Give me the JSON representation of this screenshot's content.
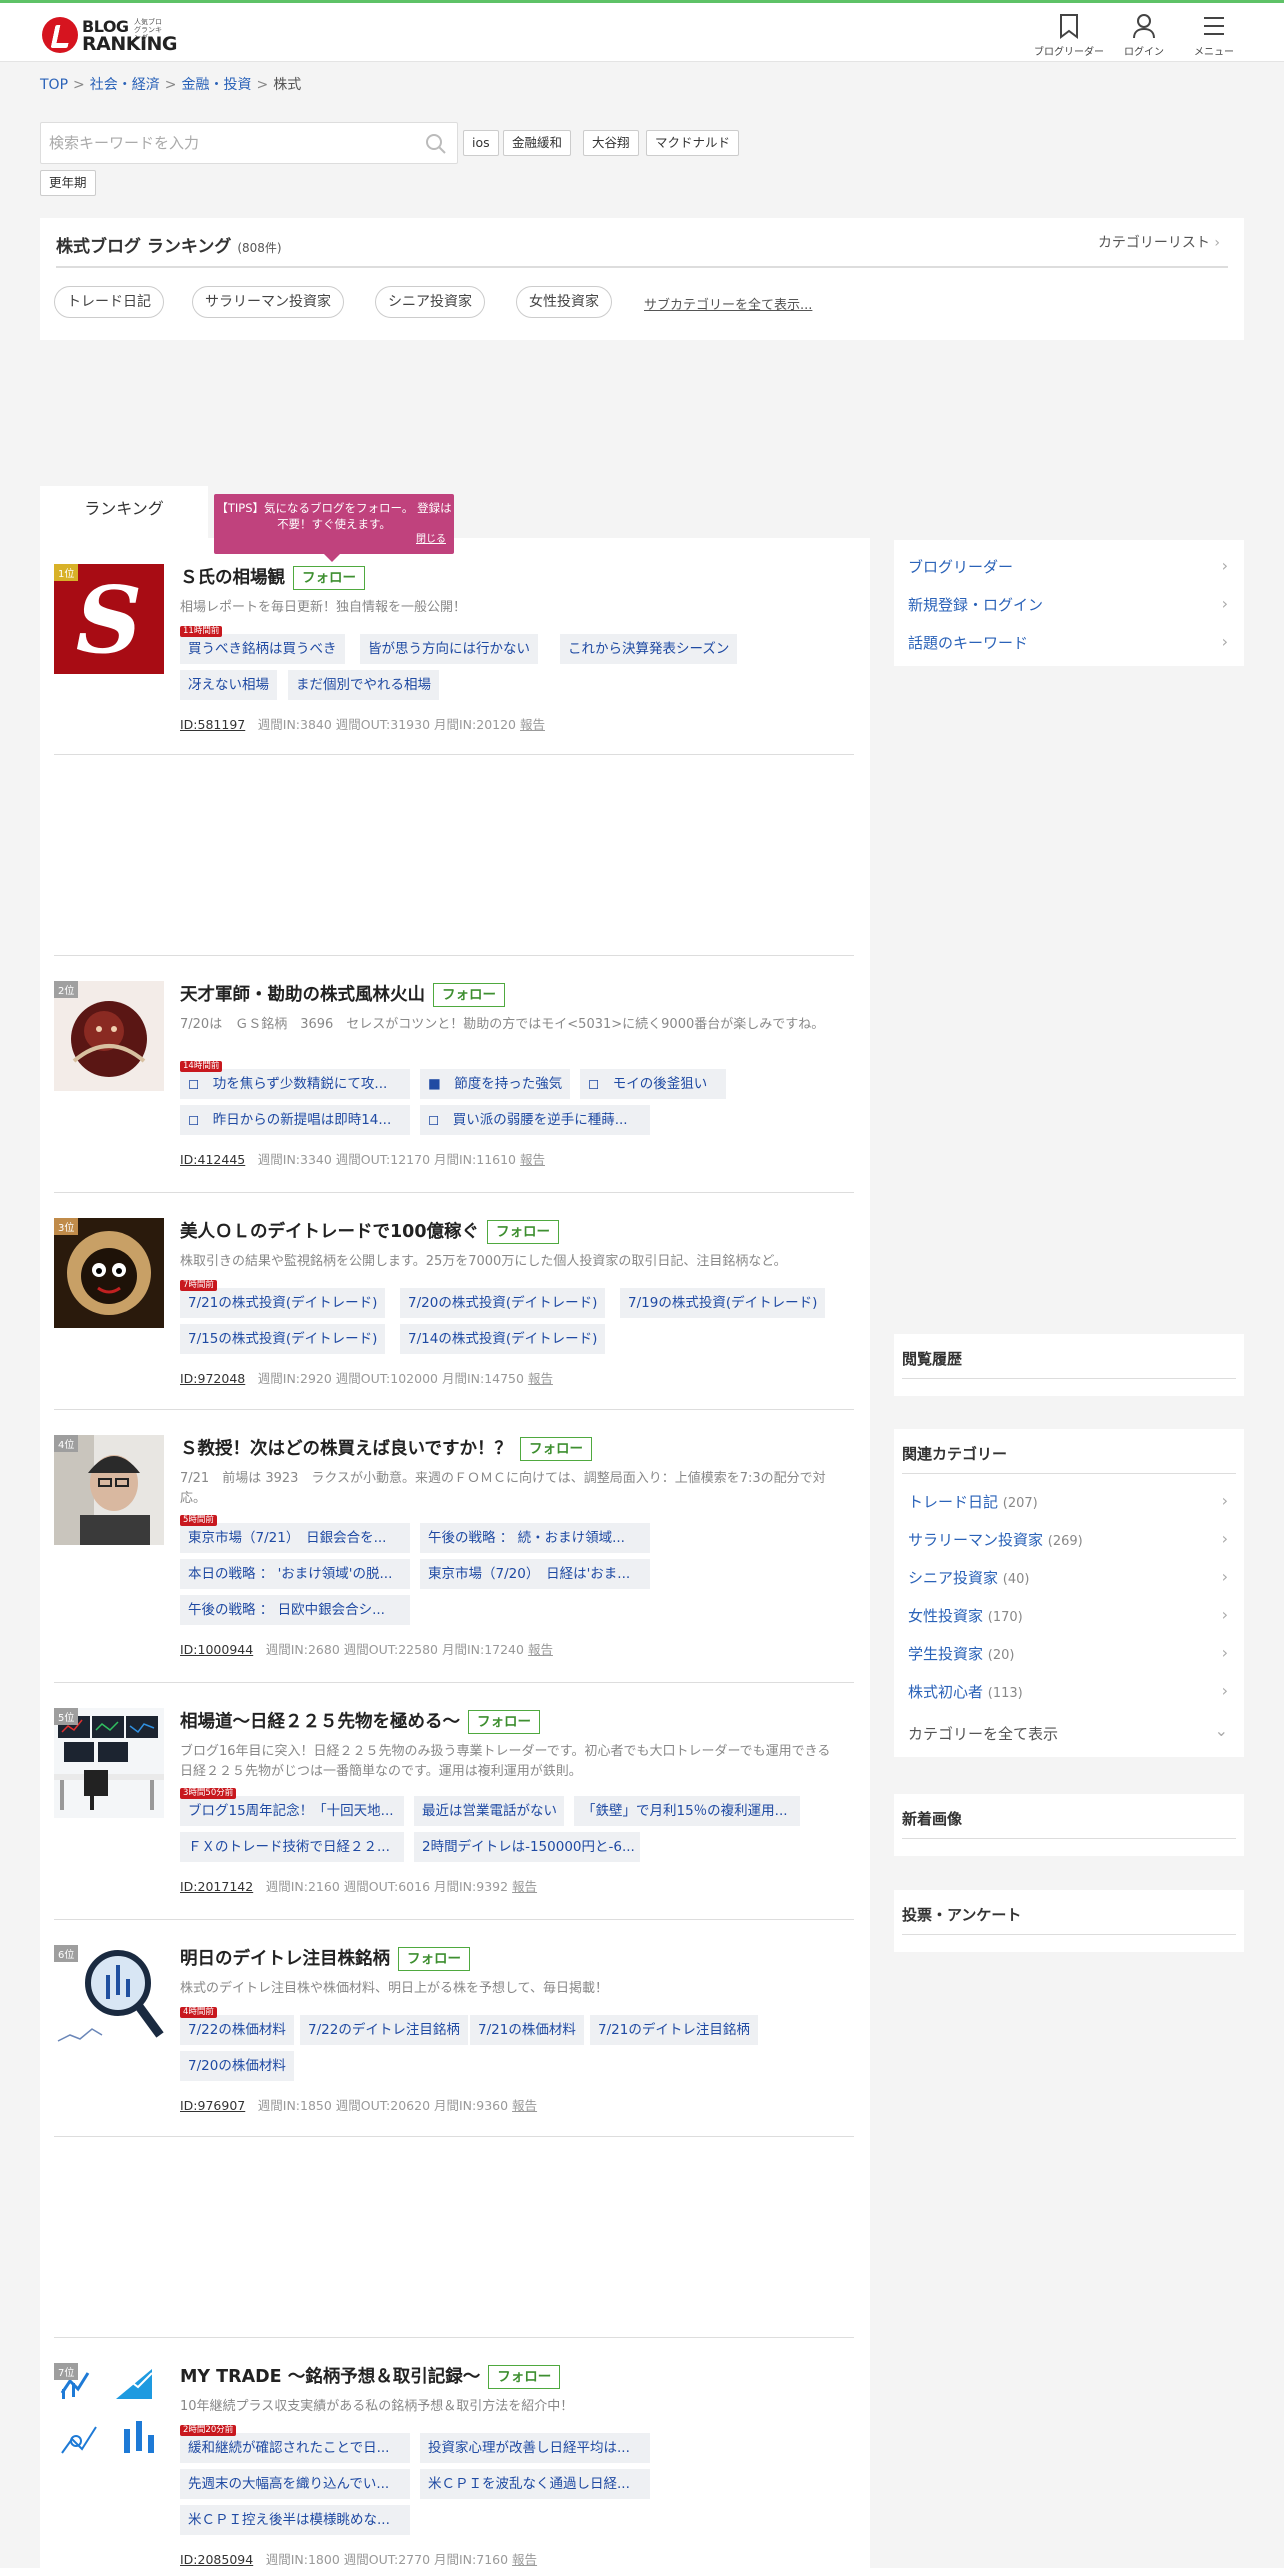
{
  "header": {
    "logo_text_1": "BLOG",
    "logo_text_2": "RANKING",
    "logo_small": "人気ブログランキング",
    "nav": [
      {
        "label": "ブログリーダー",
        "icon": "bookmark-icon"
      },
      {
        "label": "ログイン",
        "icon": "user-icon"
      },
      {
        "label": "メニュー",
        "icon": "hamburger-icon"
      }
    ]
  },
  "breadcrumb": {
    "items": [
      "TOP",
      "社会・経済",
      "金融・投資"
    ],
    "current": "株式",
    "sep": ">"
  },
  "search": {
    "placeholder": "検索キーワードを入力",
    "keywords": [
      "ios",
      "金融緩和",
      "大谷翔",
      "マクドナルド",
      "更年期"
    ]
  },
  "ranking_header": {
    "title": "株式ブログ ランキング",
    "count": "(808件)",
    "category_list": "カテゴリーリスト",
    "pills": [
      "トレード日記",
      "サラリーマン投資家",
      "シニア投資家",
      "女性投資家"
    ],
    "subcat_link": "サブカテゴリーを全て表示..."
  },
  "tab": {
    "label": "ランキング"
  },
  "tips": {
    "text": "【TIPS】気になるブログをフォロー。 登録は不要！すぐ使えます。",
    "close": "閉じる"
  },
  "follow_label": "フォロー",
  "entries": [
    {
      "rank": "1位",
      "title": "Ｓ氏の相場観",
      "desc": "相場レポートを毎日更新！独自情報を一般公開！",
      "badge": "11時間前",
      "tags": [
        "買うべき銘柄は買うべき",
        "皆が思う方向には行かない",
        "これから決算発表シーズン",
        "冴えない相場",
        "まだ個別でやれる相場"
      ],
      "id": "ID:581197",
      "stats": "週間IN:3840 週間OUT:31930 月間IN:20120",
      "report": "報告"
    },
    {
      "rank": "2位",
      "title": "天才軍師・勘助の株式風林火山",
      "desc": "7/20は　ＧＳ銘柄　3696　セレスがコツンと！勘助の方ではモイ<5031>に続く9000番台が楽しみですね。",
      "badge": "14時間前",
      "tags": [
        "◻　功を焦らず少数精鋭にて攻...",
        "■　節度を持った強気",
        "◻　モイの後釜狙い",
        "◻　昨日からの新提唱は即時14...",
        "◻　買い派の弱腰を逆手に種蒔..."
      ],
      "id": "ID:412445",
      "stats": "週間IN:3340 週間OUT:12170 月間IN:11610",
      "report": "報告"
    },
    {
      "rank": "3位",
      "title": "美人ＯＬのデイトレードで100億稼ぐ",
      "desc": "株取引きの結果や監視銘柄を公開します。25万を7000万にした個人投資家の取引日記、注目銘柄など。",
      "badge": "7時間前",
      "tags": [
        "7/21の株式投資(デイトレード)",
        "7/20の株式投資(デイトレード)",
        "7/19の株式投資(デイトレード)",
        "7/15の株式投資(デイトレード)",
        "7/14の株式投資(デイトレード)"
      ],
      "id": "ID:972048",
      "stats": "週間IN:2920 週間OUT:102000 月間IN:14750",
      "report": "報告"
    },
    {
      "rank": "4位",
      "title": "Ｓ教授！次はどの株買えば良いですか！？",
      "desc": "7/21　前場は 3923　ラクスが小動意。来週のＦＯＭＣに向けては、調整局面入り：上値模索を7:3の配分で対応。",
      "badge": "5時間前",
      "tags": [
        "東京市場（7/21）　日銀会合を...",
        "午後の戦略 ： 続・おまけ領域...",
        "本日の戦略 ： 'おまけ領域'の脱...",
        "東京市場（7/20）　日経は'おま...",
        "午後の戦略 ： 日欧中銀会合シ..."
      ],
      "id": "ID:1000944",
      "stats": "週間IN:2680 週間OUT:22580 月間IN:17240",
      "report": "報告"
    },
    {
      "rank": "5位",
      "title": "相場道〜日経２２５先物を極める〜",
      "desc": "ブログ16年目に突入！日経２２５先物のみ扱う専業トレーダーです。初心者でも大口トレーダーでも運用できる日経２２５先物がじつは一番簡単なのです。運用は複利運用が鉄則。",
      "badge": "3時間50分前",
      "tags": [
        "ブログ15周年記念！「十回天地...",
        "最近は営業電話がない",
        "「鉄壁」で月利15％の複利運用...",
        "ＦＸのトレード技術で日経２２...",
        "2時間デイトレは-150000円と-6..."
      ],
      "id": "ID:2017142",
      "stats": "週間IN:2160 週間OUT:6016 月間IN:9392",
      "report": "報告"
    },
    {
      "rank": "6位",
      "title": "明日のデイトレ注目株銘柄",
      "desc": "株式のデイトレ注目株や株価材料、明日上がる株を予想して、毎日掲載！",
      "badge": "4時間前",
      "tags": [
        "7/22の株価材料",
        "7/22のデイトレ注目銘柄",
        "7/21の株価材料",
        "7/21のデイトレ注目銘柄",
        "7/20の株価材料"
      ],
      "id": "ID:976907",
      "stats": "週間IN:1850 週間OUT:20620 月間IN:9360",
      "report": "報告"
    },
    {
      "rank": "7位",
      "title": "MY TRADE 〜銘柄予想＆取引記録〜",
      "desc": "10年継続プラス収支実績がある私の銘柄予想＆取引方法を紹介中！",
      "badge": "2時間20分前",
      "tags": [
        "緩和継続が確認されたことで日...",
        "投資家心理が改善し日経平均は...",
        "先週末の大幅高を織り込んでい...",
        "米ＣＰＩを波乱なく通過し日経...",
        "米ＣＰＩ控え後半は模様眺めな..."
      ],
      "id": "ID:2085094",
      "stats": "週間IN:1800 週間OUT:2770 月間IN:7160",
      "report": "報告"
    }
  ],
  "sidebar": {
    "links": [
      "ブログリーダー",
      "新規登録・ログイン",
      "話題のキーワード"
    ],
    "history_title": "閲覧履歴",
    "related_title": "関連カテゴリー",
    "related": [
      {
        "label": "トレード日記",
        "count": "(207)"
      },
      {
        "label": "サラリーマン投資家",
        "count": "(269)"
      },
      {
        "label": "シニア投資家",
        "count": "(40)"
      },
      {
        "label": "女性投資家",
        "count": "(170)"
      },
      {
        "label": "学生投資家",
        "count": "(20)"
      },
      {
        "label": "株式初心者",
        "count": "(113)"
      }
    ],
    "show_all": "カテゴリーを全て表示",
    "new_images": "新着画像",
    "votes": "投票・アンケート"
  }
}
